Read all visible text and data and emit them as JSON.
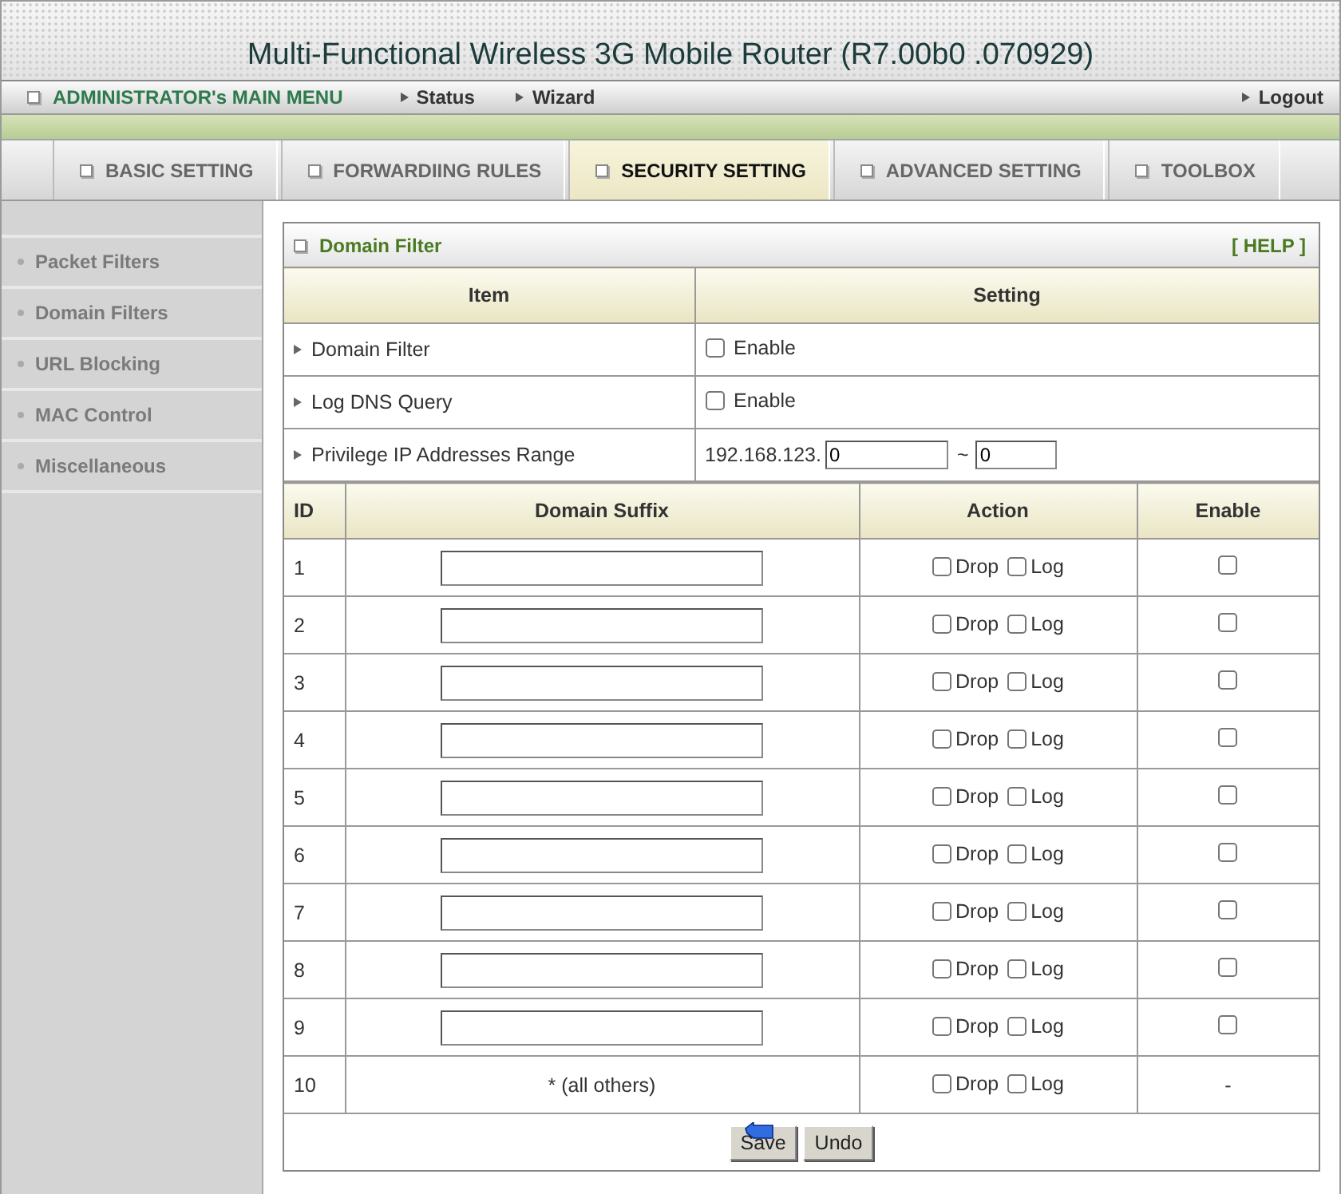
{
  "window": {
    "title": "Multi-Functional Wireless 3G Mobile Router (R7.00b0 .070929)"
  },
  "menu": {
    "title": "ADMINISTRATOR's MAIN MENU",
    "links": [
      "Status",
      "Wizard"
    ],
    "logout": "Logout"
  },
  "tabs": [
    {
      "label": "BASIC SETTING",
      "selected": false
    },
    {
      "label": "FORWARDIING RULES",
      "selected": false
    },
    {
      "label": "SECURITY SETTING",
      "selected": true
    },
    {
      "label": "ADVANCED SETTING",
      "selected": false
    },
    {
      "label": "TOOLBOX",
      "selected": false
    }
  ],
  "sidebar": {
    "items": [
      "Packet Filters",
      "Domain Filters",
      "URL Blocking",
      "MAC Control",
      "Miscellaneous"
    ]
  },
  "panel": {
    "title": "Domain Filter",
    "help": "[ HELP ]",
    "columns": [
      "Item",
      "Setting"
    ],
    "settings": [
      {
        "kind": "checkbox",
        "label": "Domain Filter",
        "option": "Enable",
        "checked": false
      },
      {
        "kind": "checkbox",
        "label": "Log DNS Query",
        "option": "Enable",
        "checked": false
      },
      {
        "kind": "ip_range",
        "label": "Privilege IP Addresses Range",
        "prefix": "192.168.123.",
        "from": "0",
        "separator": "~",
        "to": "0"
      }
    ],
    "rules": {
      "columns": [
        "ID",
        "Domain Suffix",
        "Action",
        "Enable"
      ],
      "rows": [
        {
          "id": "1",
          "kind": "input",
          "drop_label": "Drop",
          "drop": false,
          "log_label": "Log",
          "log": false,
          "enabled": false
        },
        {
          "id": "2",
          "kind": "input",
          "drop_label": "Drop",
          "drop": false,
          "log_label": "Log",
          "log": false,
          "enabled": false
        },
        {
          "id": "3",
          "kind": "input",
          "drop_label": "Drop",
          "drop": false,
          "log_label": "Log",
          "log": false,
          "enabled": false
        },
        {
          "id": "4",
          "kind": "input",
          "drop_label": "Drop",
          "drop": false,
          "log_label": "Log",
          "log": false,
          "enabled": false
        },
        {
          "id": "5",
          "kind": "input",
          "drop_label": "Drop",
          "drop": false,
          "log_label": "Log",
          "log": false,
          "enabled": false
        },
        {
          "id": "6",
          "kind": "input",
          "drop_label": "Drop",
          "drop": false,
          "log_label": "Log",
          "log": false,
          "enabled": false
        },
        {
          "id": "7",
          "kind": "input",
          "drop_label": "Drop",
          "drop": false,
          "log_label": "Log",
          "log": false,
          "enabled": false
        },
        {
          "id": "8",
          "kind": "input",
          "drop_label": "Drop",
          "drop": false,
          "log_label": "Log",
          "log": false,
          "enabled": false
        },
        {
          "id": "9",
          "kind": "input",
          "drop_label": "Drop",
          "drop": false,
          "log_label": "Log",
          "log": false,
          "enabled": false
        },
        {
          "id": "10",
          "kind": "text",
          "suffix": "* (all others)",
          "drop_label": "Drop",
          "drop": false,
          "log_label": "Log",
          "log": false,
          "enable_text": "-"
        }
      ]
    },
    "buttons": [
      "Save",
      "Undo"
    ]
  }
}
